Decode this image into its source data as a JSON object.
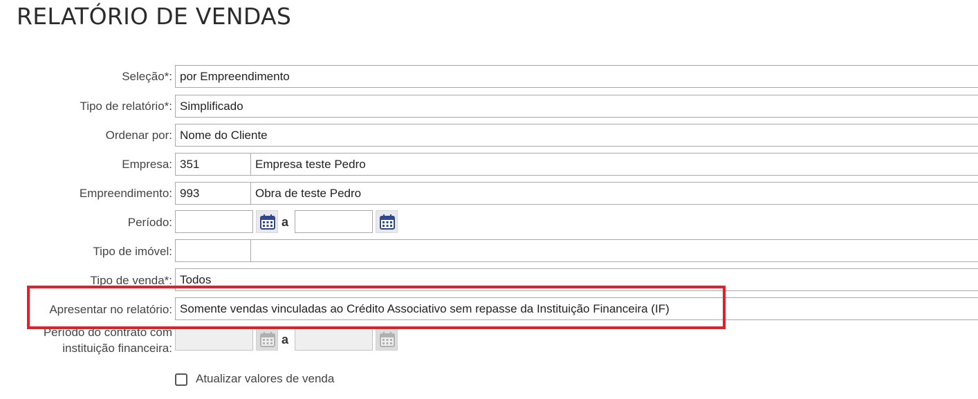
{
  "page": {
    "title": "RELATÓRIO DE VENDAS"
  },
  "form": {
    "selecao": {
      "label": "Seleção*:",
      "value": "por Empreendimento"
    },
    "tipo_relatorio": {
      "label": "Tipo de relatório*:",
      "value": "Simplificado"
    },
    "ordenar_por": {
      "label": "Ordenar por:",
      "value": "Nome do Cliente"
    },
    "empresa": {
      "label": "Empresa:",
      "code": "351",
      "name": "Empresa teste Pedro"
    },
    "empreendimento": {
      "label": "Empreendimento:",
      "code": "993",
      "name": "Obra de teste Pedro"
    },
    "periodo": {
      "label": "Período:",
      "from": "",
      "to": "",
      "separator": "a"
    },
    "tipo_imovel": {
      "label": "Tipo de imóvel:",
      "code": "",
      "name": ""
    },
    "tipo_venda": {
      "label": "Tipo de venda*:",
      "value": "Todos"
    },
    "apresentar": {
      "label": "Apresentar no relatório:",
      "value": "Somente vendas vinculadas ao Crédito Associativo sem repasse da Instituição Financeira (IF)"
    },
    "periodo_contrato": {
      "label_line1": "Período do contrato com",
      "label_line2": "instituição financeira:",
      "from": "",
      "to": "",
      "separator": "a"
    },
    "atualizar": {
      "label": "Atualizar valores de venda",
      "checked": false
    }
  },
  "icons": {
    "calendar": "calendar-icon"
  },
  "colors": {
    "highlight": "#e2202a",
    "calendar_blue": "#2f4a8c"
  }
}
